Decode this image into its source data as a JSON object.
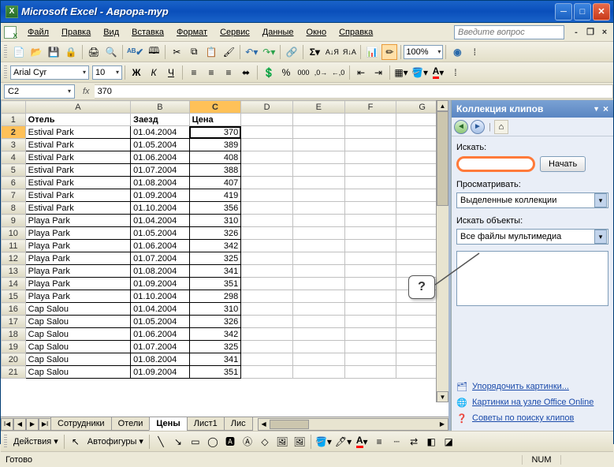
{
  "window": {
    "title": "Microsoft Excel - Аврора-тур"
  },
  "menu": {
    "items": [
      "Файл",
      "Правка",
      "Вид",
      "Вставка",
      "Формат",
      "Сервис",
      "Данные",
      "Окно",
      "Справка"
    ],
    "ask_placeholder": "Введите вопрос"
  },
  "toolbar_std": {
    "zoom": "100%"
  },
  "toolbar_fmt": {
    "font": "Arial Cyr",
    "size": "10"
  },
  "formula": {
    "name_box": "C2",
    "fx": "fx",
    "value": "370"
  },
  "grid": {
    "col_labels": [
      "A",
      "B",
      "C",
      "D",
      "E",
      "F",
      "G"
    ],
    "selected_cell": "C2",
    "columns": [
      "Отель",
      "Заезд",
      "Цена"
    ],
    "rows": [
      {
        "n": 2,
        "a": "Estival Park",
        "b": "01.04.2004",
        "c": "370"
      },
      {
        "n": 3,
        "a": "Estival Park",
        "b": "01.05.2004",
        "c": "389"
      },
      {
        "n": 4,
        "a": "Estival Park",
        "b": "01.06.2004",
        "c": "408"
      },
      {
        "n": 5,
        "a": "Estival Park",
        "b": "01.07.2004",
        "c": "388"
      },
      {
        "n": 6,
        "a": "Estival Park",
        "b": "01.08.2004",
        "c": "407"
      },
      {
        "n": 7,
        "a": "Estival Park",
        "b": "01.09.2004",
        "c": "419"
      },
      {
        "n": 8,
        "a": "Estival Park",
        "b": "01.10.2004",
        "c": "356"
      },
      {
        "n": 9,
        "a": "Playa Park",
        "b": "01.04.2004",
        "c": "310"
      },
      {
        "n": 10,
        "a": "Playa Park",
        "b": "01.05.2004",
        "c": "326"
      },
      {
        "n": 11,
        "a": "Playa Park",
        "b": "01.06.2004",
        "c": "342"
      },
      {
        "n": 12,
        "a": "Playa Park",
        "b": "01.07.2004",
        "c": "325"
      },
      {
        "n": 13,
        "a": "Playa Park",
        "b": "01.08.2004",
        "c": "341"
      },
      {
        "n": 14,
        "a": "Playa Park",
        "b": "01.09.2004",
        "c": "351"
      },
      {
        "n": 15,
        "a": "Playa Park",
        "b": "01.10.2004",
        "c": "298"
      },
      {
        "n": 16,
        "a": "Cap Salou",
        "b": "01.04.2004",
        "c": "310"
      },
      {
        "n": 17,
        "a": "Cap Salou",
        "b": "01.05.2004",
        "c": "326"
      },
      {
        "n": 18,
        "a": "Cap Salou",
        "b": "01.06.2004",
        "c": "342"
      },
      {
        "n": 19,
        "a": "Cap Salou",
        "b": "01.07.2004",
        "c": "325"
      },
      {
        "n": 20,
        "a": "Cap Salou",
        "b": "01.08.2004",
        "c": "341"
      },
      {
        "n": 21,
        "a": "Cap Salou",
        "b": "01.09.2004",
        "c": "351"
      }
    ]
  },
  "sheet_tabs": [
    "Сотрудники",
    "Отели",
    "Цены",
    "Лист1",
    "Лис"
  ],
  "active_tab": "Цены",
  "taskpane": {
    "title": "Коллекция клипов",
    "search_label": "Искать:",
    "search_btn": "Начать",
    "browse_label": "Просматривать:",
    "browse_value": "Выделенные коллекции",
    "objects_label": "Искать объекты:",
    "objects_value": "Все файлы мультимедиа",
    "link_organize": "Упорядочить картинки...",
    "link_online": "Картинки на узле Office Online",
    "link_tips": "Советы по поиску клипов"
  },
  "callout": {
    "text": "?"
  },
  "drawbar": {
    "actions": "Действия",
    "autoshapes": "Автофигуры"
  },
  "status": {
    "ready": "Готово",
    "num": "NUM"
  }
}
